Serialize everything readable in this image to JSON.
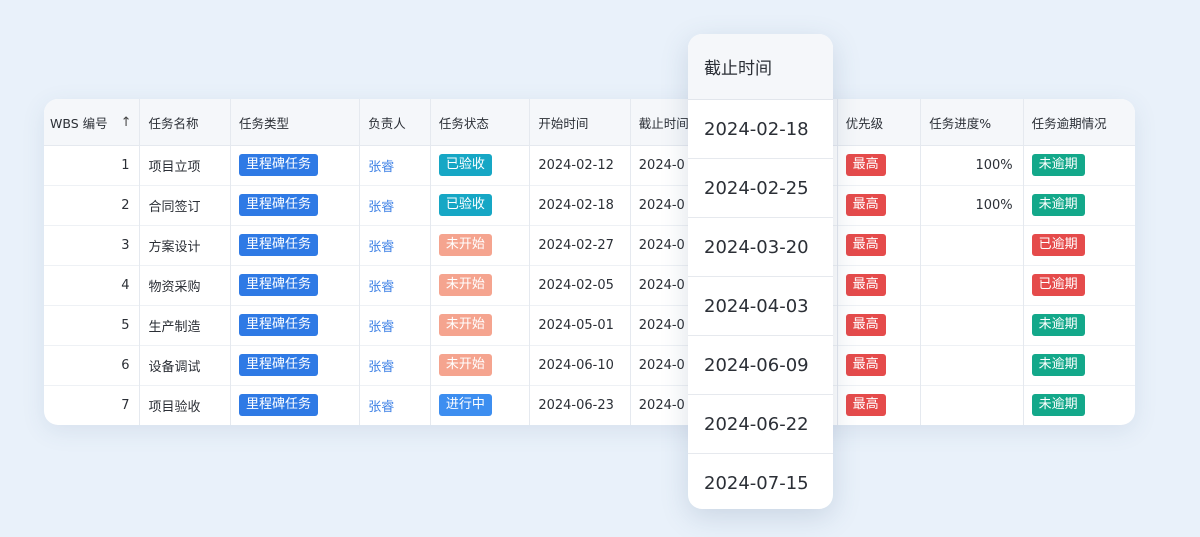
{
  "table": {
    "headers": [
      "WBS 编号",
      "任务名称",
      "任务类型",
      "负责人",
      "任务状态",
      "开始时间",
      "截止时间",
      "",
      "优先级",
      "任务进度%",
      "任务逾期情况"
    ],
    "sort_icon": "arrow-up-icon",
    "rows": [
      {
        "wbs": "1",
        "name": "项目立项",
        "type": "里程碑任务",
        "owner": "张睿",
        "status": "已验收",
        "status_color": "#16a7c5",
        "start": "2024-02-12",
        "end": "2024-0",
        "priority": "最高",
        "progress": "100%",
        "overdue": "未逾期",
        "overdue_color": "#13a88a"
      },
      {
        "wbs": "2",
        "name": "合同签订",
        "type": "里程碑任务",
        "owner": "张睿",
        "status": "已验收",
        "status_color": "#16a7c5",
        "start": "2024-02-18",
        "end": "2024-0",
        "priority": "最高",
        "progress": "100%",
        "overdue": "未逾期",
        "overdue_color": "#13a88a"
      },
      {
        "wbs": "3",
        "name": "方案设计",
        "type": "里程碑任务",
        "owner": "张睿",
        "status": "未开始",
        "status_color": "#f5a48f",
        "start": "2024-02-27",
        "end": "2024-0",
        "priority": "最高",
        "progress": "",
        "overdue": "已逾期",
        "overdue_color": "#e54b4b"
      },
      {
        "wbs": "4",
        "name": "物资采购",
        "type": "里程碑任务",
        "owner": "张睿",
        "status": "未开始",
        "status_color": "#f5a48f",
        "start": "2024-02-05",
        "end": "2024-0",
        "priority": "最高",
        "progress": "",
        "overdue": "已逾期",
        "overdue_color": "#e54b4b"
      },
      {
        "wbs": "5",
        "name": "生产制造",
        "type": "里程碑任务",
        "owner": "张睿",
        "status": "未开始",
        "status_color": "#f5a48f",
        "start": "2024-05-01",
        "end": "2024-0",
        "priority": "最高",
        "progress": "",
        "overdue": "未逾期",
        "overdue_color": "#13a88a"
      },
      {
        "wbs": "6",
        "name": "设备调试",
        "type": "里程碑任务",
        "owner": "张睿",
        "status": "未开始",
        "status_color": "#f5a48f",
        "start": "2024-06-10",
        "end": "2024-0",
        "priority": "最高",
        "progress": "",
        "overdue": "未逾期",
        "overdue_color": "#13a88a"
      },
      {
        "wbs": "7",
        "name": "项目验收",
        "type": "里程碑任务",
        "owner": "张睿",
        "status": "进行中",
        "status_color": "#3d8ef0",
        "start": "2024-06-23",
        "end": "2024-0",
        "priority": "最高",
        "progress": "",
        "overdue": "未逾期",
        "overdue_color": "#13a88a"
      }
    ],
    "colors": {
      "type_tag": "#2f7ae5",
      "priority_tag": "#e54b4b",
      "owner_text": "#3f82e6"
    }
  },
  "popup": {
    "title": "截止时间",
    "items": [
      "2024-02-18",
      "2024-02-25",
      "2024-03-20",
      "2024-04-03",
      "2024-06-09",
      "2024-06-22",
      "2024-07-15"
    ]
  }
}
